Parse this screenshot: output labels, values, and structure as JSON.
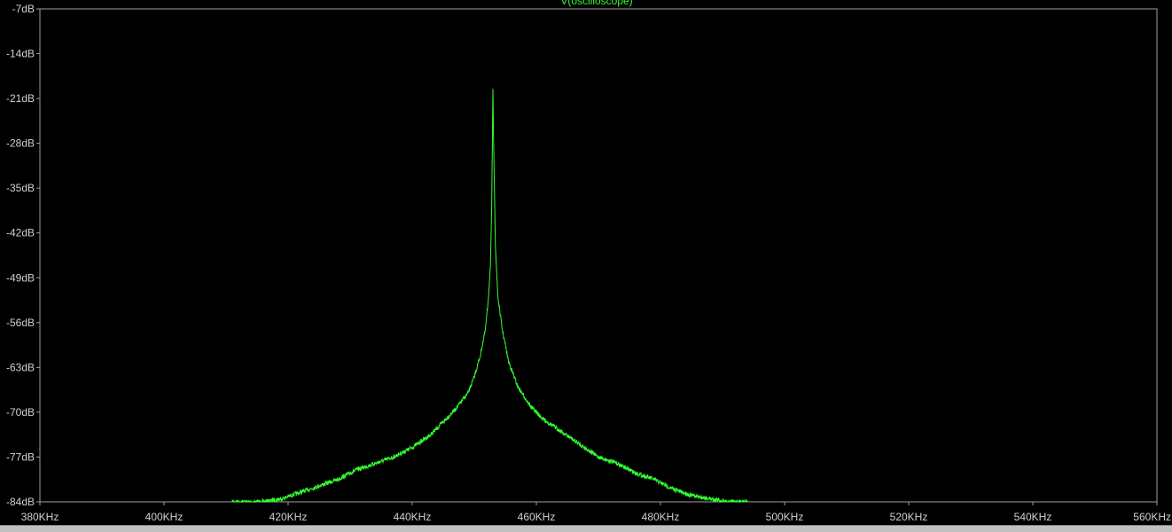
{
  "window": {
    "trace_label": "V(oscilloscope)"
  },
  "colors": {
    "background": "#000000",
    "frame": "#a0a0a0",
    "axis_text": "#d4d0c8",
    "trace": "#33ff33",
    "status_strip": "#c0c0c0"
  },
  "chart_data": {
    "type": "line",
    "title": "V(oscilloscope)",
    "xlabel": "",
    "ylabel": "",
    "x_unit": "Hz",
    "y_unit": "dB",
    "xlim": [
      380000,
      560000
    ],
    "ylim": [
      -84,
      -7
    ],
    "grid": false,
    "x_tick_values": [
      380000,
      400000,
      420000,
      440000,
      460000,
      480000,
      500000,
      520000,
      540000,
      560000
    ],
    "x_tick_labels": [
      "380KHz",
      "400KHz",
      "420KHz",
      "440KHz",
      "460KHz",
      "480KHz",
      "500KHz",
      "520KHz",
      "540KHz",
      "560KHz"
    ],
    "y_tick_values": [
      -7,
      -14,
      -21,
      -28,
      -35,
      -42,
      -49,
      -56,
      -63,
      -70,
      -77,
      -84
    ],
    "y_tick_labels": [
      "-7dB",
      "-14dB",
      "-21dB",
      "-28dB",
      "-35dB",
      "-42dB",
      "-49dB",
      "-56dB",
      "-63dB",
      "-70dB",
      "-77dB",
      "-84dB"
    ],
    "series": [
      {
        "color": "#33ff33",
        "x": [
          411000,
          413000,
          416000,
          419000,
          422000,
          425000,
          428000,
          431000,
          434000,
          437000,
          440000,
          443000,
          445000,
          447000,
          449000,
          450000,
          451000,
          451800,
          452300,
          452600,
          452800,
          452900,
          453000,
          453100,
          453400,
          453800,
          454500,
          455500,
          457000,
          459000,
          461000,
          464000,
          467000,
          470000,
          473000,
          476000,
          479000,
          482000,
          485000,
          488000,
          491000,
          494000
        ],
        "y": [
          -84,
          -84,
          -84,
          -83.5,
          -82.5,
          -81.5,
          -80.5,
          -79,
          -78,
          -77,
          -75.5,
          -73.5,
          -71.5,
          -69.5,
          -67,
          -64.5,
          -61,
          -57,
          -52,
          -47,
          -38,
          -29,
          -19.5,
          -27,
          -44,
          -52,
          -57,
          -62,
          -66,
          -69,
          -71,
          -73,
          -75,
          -77,
          -78,
          -79.5,
          -80.5,
          -82,
          -83,
          -83.5,
          -84,
          -84
        ]
      }
    ]
  }
}
